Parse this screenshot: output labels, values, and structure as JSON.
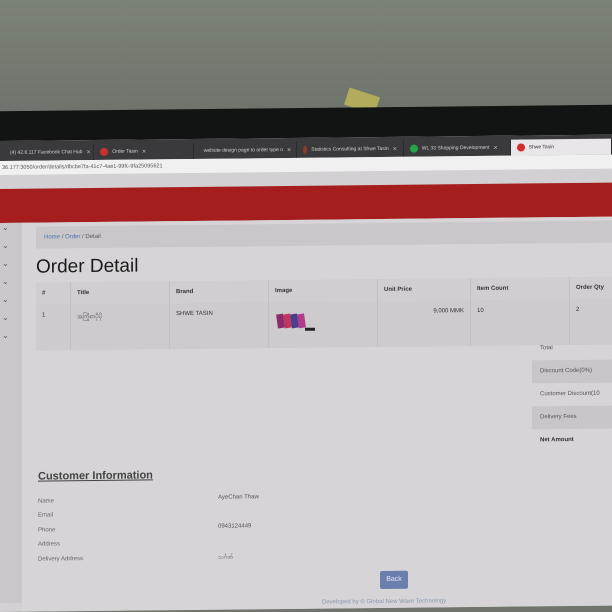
{
  "browser": {
    "tabs": [
      {
        "title": "(4) 42.6.117 Facebook Chat Hub",
        "color": "#c8312c"
      },
      {
        "title": "Order Tasin",
        "color": "#c8312c"
      },
      {
        "title": "website design page to order type n",
        "color": "#dcdcdc"
      },
      {
        "title": "Statistics Consulting at Shwe Tasin",
        "color": "#8a3b2a"
      },
      {
        "title": "WL 33 Shopping Development",
        "color": "#27a34a"
      },
      {
        "title": "Shwe Tasin",
        "color": "#d22c2c"
      }
    ],
    "url": "36.177:3050/order/details/dbcbe7fa-41c7-4ae1-99fc-9fa25095621"
  },
  "breadcrumb": {
    "home": "Home",
    "order": "Order",
    "current": "Detail",
    "sep": "/"
  },
  "page_title": "Order Detail",
  "table": {
    "headers": [
      "#",
      "Title",
      "Brand",
      "Image",
      "Unit Price",
      "Item Count",
      "Order Qty"
    ],
    "rows": [
      {
        "no": "1",
        "title": "အကြိုစာပိုပို",
        "brand": "SHWE TASIN",
        "unit_price": "9,000 MMK",
        "item_count": "10",
        "order_qty": "2"
      }
    ]
  },
  "summary": [
    "Total",
    "Discount Code(0%)",
    "Customer Discount(10",
    "Delivery Fees",
    "Net Amount"
  ],
  "customer": {
    "heading": "Customer Information",
    "labels": [
      "Name",
      "Email",
      "Phone",
      "Address",
      "Delivery Address"
    ],
    "name": "AyeChan Thaw",
    "phone": "0943124449",
    "delivery": "သင်္ဂဏ်"
  },
  "back_label": "Back",
  "footer": "Developed by © Global New Wave Technology"
}
